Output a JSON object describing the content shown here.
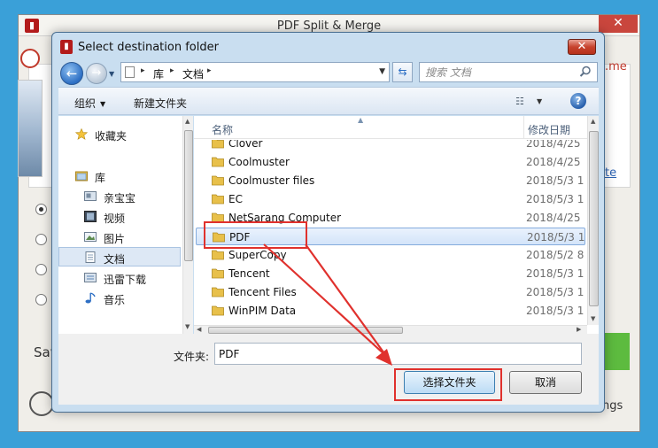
{
  "background_app": {
    "title": "PDF Split & Merge",
    "right_text_top": ".me",
    "right_link": "te",
    "save_label": "Sav",
    "bottom_right_text": "ngs"
  },
  "dialog": {
    "title": "Select destination folder",
    "close_glyph": "✕"
  },
  "address": {
    "crumbs": [
      "库",
      "文档"
    ],
    "separator": "▸"
  },
  "search": {
    "placeholder": "搜索 文档"
  },
  "toolbar": {
    "organize_label": "组织",
    "new_folder_label": "新建文件夹",
    "help_glyph": "?"
  },
  "nav_pane": {
    "items": [
      {
        "label": "收藏夹",
        "icon": "star-icon"
      },
      {
        "label": "库",
        "icon": "library-icon"
      },
      {
        "label": "亲宝宝",
        "icon": "library-folder-icon"
      },
      {
        "label": "视频",
        "icon": "video-icon"
      },
      {
        "label": "图片",
        "icon": "picture-icon"
      },
      {
        "label": "文档",
        "icon": "document-icon",
        "selected": true
      },
      {
        "label": "迅雷下载",
        "icon": "download-icon"
      },
      {
        "label": "音乐",
        "icon": "music-icon"
      }
    ]
  },
  "columns": {
    "name": "名称",
    "date": "修改日期"
  },
  "files": [
    {
      "name": "Clover",
      "date": "2018/4/25"
    },
    {
      "name": "Coolmuster",
      "date": "2018/4/25"
    },
    {
      "name": "Coolmuster files",
      "date": "2018/5/3 1"
    },
    {
      "name": "EC",
      "date": "2018/5/3 1"
    },
    {
      "name": "NetSarang Computer",
      "date": "2018/4/25"
    },
    {
      "name": "PDF",
      "date": "2018/5/3 1",
      "selected": true
    },
    {
      "name": "SuperCopy",
      "date": "2018/5/2 8"
    },
    {
      "name": "Tencent",
      "date": "2018/5/3 1"
    },
    {
      "name": "Tencent Files",
      "date": "2018/5/3 1"
    },
    {
      "name": "WinPIM Data",
      "date": "2018/5/3 1"
    }
  ],
  "folder_field": {
    "label": "文件夹:",
    "value": "PDF"
  },
  "buttons": {
    "select_folder": "选择文件夹",
    "cancel": "取消"
  },
  "colors": {
    "annotation_red": "#e0312d",
    "folder_yellow": "#e8c04a",
    "selection_blue": "#84acdd"
  }
}
